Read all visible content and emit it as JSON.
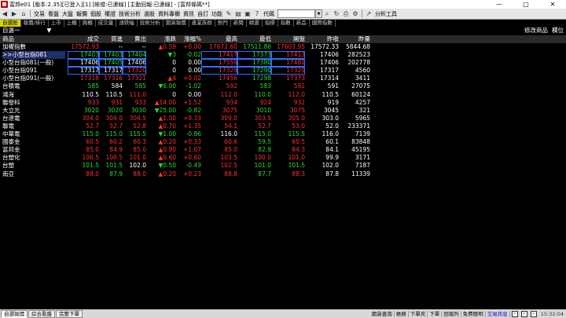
{
  "window": {
    "title": "富邦e01 [版本:2.35][已登入][1] [帳僧:已連線] [主動回報:已連線] - [富邦條碼**]",
    "min": "—",
    "max": "□",
    "close": "✕"
  },
  "toolbar": {
    "menus": [
      "交易",
      "看盤",
      "大盤",
      "報價",
      "個股",
      "權證",
      "技術分析",
      "選股",
      "資料專欄",
      "資訊",
      "自訂",
      "功能"
    ],
    "search_label": "代碼",
    "analysis_tools": "分析工具"
  },
  "tabs": [
    "自選股",
    "報價/排行",
    "上市",
    "上櫃",
    "興櫃",
    "成交量",
    "漲跌幅",
    "技術分析",
    "期貨報價",
    "產業族群",
    "熱門",
    "新聞",
    "精選",
    "指標",
    "指數",
    "新品",
    "國際指數"
  ],
  "info": {
    "group": "自選一",
    "arrow": "▼",
    "edit_btn": "修改商品",
    "field_btn": "欄位"
  },
  "columns": {
    "name": "商品",
    "vol_last": "成交",
    "bid": "買進",
    "ask": "賣出",
    "change": "漲跌",
    "pct": "漲幅%",
    "high": "最高",
    "low": "最低",
    "open": "開盤",
    "prev": "昨收",
    "qty": "昨量"
  },
  "rows": [
    {
      "name": "加權指數",
      "last": "17572.93",
      "bid": "--",
      "ask": "--",
      "chg": "▲0.59",
      "pct": "+0.00",
      "high": "17672.60",
      "low": "17511.86",
      "open": "17603.95",
      "prev": "17572.33",
      "vol": "5844.68"
    },
    {
      "name": ">>小型台指081",
      "last": "17403",
      "bid": "17403",
      "ask": "17404",
      "chg": "▼3",
      "pct": "-0.02",
      "high": "17417",
      "low": "17373",
      "open": "17413",
      "prev": "17406",
      "vol": "282523"
    },
    {
      "name": "小型台指081(一般)",
      "last": "17406",
      "bid": "17405",
      "ask": "17406",
      "chg": "0",
      "pct": "0.00",
      "high": "17559",
      "low": "17380",
      "open": "17481",
      "prev": "17406",
      "vol": "202778"
    },
    {
      "name": "小型台指091",
      "last": "17317",
      "bid": "17317",
      "ask": "17320",
      "chg": "0",
      "pct": "0.00",
      "high": "17329",
      "low": "17290",
      "open": "17329",
      "prev": "17317",
      "vol": "4560"
    },
    {
      "name": "小型台指091(一般)",
      "last": "17318",
      "bid": "17316",
      "ask": "17321",
      "chg": "▲4",
      "pct": "+0.02",
      "high": "17456",
      "low": "17298",
      "open": "17373",
      "prev": "17314",
      "vol": "3411"
    },
    {
      "name": "台積電",
      "last": "585",
      "bid": "584",
      "ask": "585",
      "chg": "▼6.00",
      "pct": "-1.02",
      "high": "592",
      "low": "583",
      "open": "592",
      "prev": "591",
      "vol": "27075"
    },
    {
      "name": "鴻海",
      "last": "110.5",
      "bid": "110.5",
      "ask": "111.0",
      "chg": "0",
      "pct": "0.00",
      "high": "112.0",
      "low": "110.0",
      "open": "112.0",
      "prev": "110.5",
      "vol": "60124"
    },
    {
      "name": "聯發科",
      "last": "933",
      "bid": "931",
      "ask": "933",
      "chg": "▲14.00",
      "pct": "+1.52",
      "high": "934",
      "low": "924",
      "open": "932",
      "prev": "919",
      "vol": "4257"
    },
    {
      "name": "大立光",
      "last": "3020",
      "bid": "3020",
      "ask": "3030",
      "chg": "▼25.00",
      "pct": "-0.82",
      "high": "3075",
      "low": "3010",
      "open": "3075",
      "prev": "3045",
      "vol": "321"
    },
    {
      "name": "台達電",
      "last": "304.0",
      "bid": "304.0",
      "ask": "304.5",
      "chg": "▲1.00",
      "pct": "+0.33",
      "high": "309.0",
      "low": "303.5",
      "open": "305.0",
      "prev": "303.0",
      "vol": "5965"
    },
    {
      "name": "聯電",
      "last": "52.7",
      "bid": "52.7",
      "ask": "52.8",
      "chg": "▲0.70",
      "pct": "+1.35",
      "high": "54.1",
      "low": "52.7",
      "open": "53.0",
      "prev": "52.0",
      "vol": "233371"
    },
    {
      "name": "中華電",
      "last": "115.0",
      "bid": "115.0",
      "ask": "115.5",
      "chg": "▼1.00",
      "pct": "-0.86",
      "high": "116.0",
      "low": "115.0",
      "open": "115.5",
      "prev": "116.0",
      "vol": "7139"
    },
    {
      "name": "國泰金",
      "last": "60.5",
      "bid": "60.2",
      "ask": "60.3",
      "chg": "▲0.20",
      "pct": "+0.33",
      "high": "60.6",
      "low": "59.5",
      "open": "60.5",
      "prev": "60.1",
      "vol": "83848"
    },
    {
      "name": "富邦金",
      "last": "85.0",
      "bid": "84.9",
      "ask": "85.0",
      "chg": "▲0.90",
      "pct": "+1.07",
      "high": "85.0",
      "low": "82.9",
      "open": "84.3",
      "prev": "84.1",
      "vol": "45195"
    },
    {
      "name": "台塑化",
      "last": "100.5",
      "bid": "100.5",
      "ask": "101.0",
      "chg": "▲0.60",
      "pct": "+0.60",
      "high": "103.5",
      "low": "100.0",
      "open": "101.0",
      "prev": "99.9",
      "vol": "3171"
    },
    {
      "name": "台塑",
      "last": "101.5",
      "bid": "101.5",
      "ask": "102.0",
      "chg": "▼0.50",
      "pct": "-0.49",
      "high": "102.5",
      "low": "101.0",
      "open": "101.5",
      "prev": "102.0",
      "vol": "7187"
    },
    {
      "name": "南亞",
      "last": "88.0",
      "bid": "87.9",
      "ask": "88.0",
      "chg": "▲0.20",
      "pct": "+0.23",
      "high": "88.8",
      "low": "87.7",
      "open": "88.3",
      "prev": "87.8",
      "vol": "11339"
    }
  ],
  "row_colors": [
    {
      "last": "red",
      "bid": "white",
      "ask": "white",
      "chg": "red",
      "pct": "red",
      "high": "red",
      "low": "green",
      "open": "red",
      "lastbg": "red"
    },
    {
      "last": "green",
      "bid": "green",
      "ask": "green",
      "chg": "green",
      "pct": "green",
      "high": "red",
      "low": "green",
      "open": "red",
      "lastbg": "green"
    },
    {
      "last": "white",
      "bid": "green",
      "ask": "white",
      "chg": "white",
      "pct": "white",
      "high": "red",
      "low": "green",
      "open": "red",
      "lastbg": ""
    },
    {
      "last": "white",
      "bid": "white",
      "ask": "red",
      "chg": "white",
      "pct": "white",
      "high": "red",
      "low": "green",
      "open": "red",
      "lastbg": ""
    },
    {
      "last": "red",
      "bid": "red",
      "ask": "red",
      "chg": "red",
      "pct": "red",
      "high": "red",
      "low": "green",
      "open": "red",
      "lastbg": "red"
    },
    {
      "last": "green",
      "bid": "white",
      "ask": "green",
      "chg": "green",
      "pct": "green",
      "high": "red",
      "low": "green",
      "open": "red",
      "lastbg": "green"
    },
    {
      "last": "white",
      "bid": "white",
      "ask": "red",
      "chg": "white",
      "pct": "white",
      "high": "red",
      "low": "green",
      "open": "red",
      "lastbg": ""
    },
    {
      "last": "red",
      "bid": "red",
      "ask": "red",
      "chg": "red",
      "pct": "red",
      "high": "red",
      "low": "red",
      "open": "red",
      "lastbg": "red"
    },
    {
      "last": "green",
      "bid": "green",
      "ask": "green",
      "chg": "green",
      "pct": "green",
      "high": "red",
      "low": "green",
      "open": "red",
      "lastbg": "green"
    },
    {
      "last": "red",
      "bid": "red",
      "ask": "red",
      "chg": "red",
      "pct": "red",
      "high": "red",
      "low": "red",
      "open": "red",
      "lastbg": "red"
    },
    {
      "last": "red",
      "bid": "red",
      "ask": "red",
      "chg": "red",
      "pct": "red",
      "high": "red",
      "low": "red",
      "open": "red",
      "lastbg": "red"
    },
    {
      "last": "green",
      "bid": "green",
      "ask": "green",
      "chg": "green",
      "pct": "green",
      "high": "white",
      "low": "green",
      "open": "green",
      "lastbg": "green"
    },
    {
      "last": "red",
      "bid": "red",
      "ask": "red",
      "chg": "red",
      "pct": "red",
      "high": "red",
      "low": "green",
      "open": "red",
      "lastbg": "red"
    },
    {
      "last": "red",
      "bid": "red",
      "ask": "red",
      "chg": "red",
      "pct": "red",
      "high": "red",
      "low": "green",
      "open": "red",
      "lastbg": "red"
    },
    {
      "last": "red",
      "bid": "red",
      "ask": "red",
      "chg": "red",
      "pct": "red",
      "high": "red",
      "low": "red",
      "open": "red",
      "lastbg": "red"
    },
    {
      "last": "green",
      "bid": "green",
      "ask": "white",
      "chg": "green",
      "pct": "green",
      "high": "red",
      "low": "green",
      "open": "green",
      "lastbg": "green"
    },
    {
      "last": "red",
      "bid": "green",
      "ask": "red",
      "chg": "red",
      "pct": "red",
      "high": "red",
      "low": "green",
      "open": "red",
      "lastbg": "red"
    }
  ],
  "statusbar": {
    "tabs": [
      "自選報價",
      "綜合看盤",
      "完整下單"
    ],
    "buttons": [
      "帳務",
      "下單夾",
      "下單",
      "回報列",
      "免費聽明",
      "交易訊息"
    ],
    "hint": "期貨查詢",
    "clock": "15:32:04"
  }
}
